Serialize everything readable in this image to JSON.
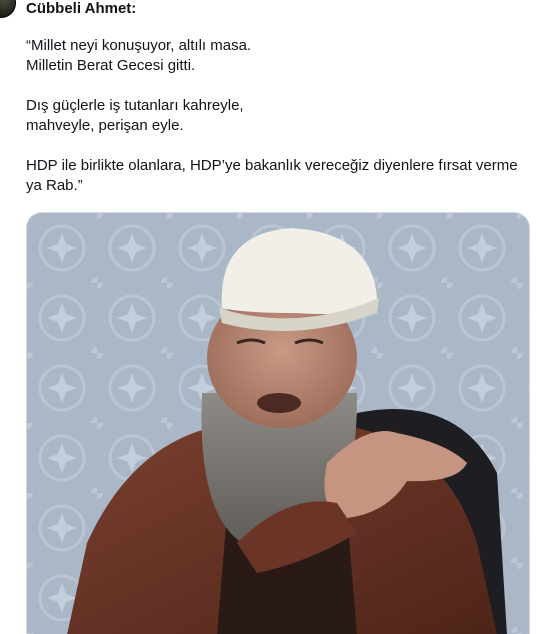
{
  "tweet": {
    "author_name": "Cübbeli Ahmet",
    "author_suffix": ":",
    "paragraphs": [
      [
        "“Millet neyi konuşuyor, altılı masa.",
        "Milletin Berat Gecesi gitti."
      ],
      [
        "Dış güçlerle iş tutanları kahreyle,",
        "mahveyle, perişan eyle."
      ],
      [
        "HDP ile birlikte olanlara, HDP’ye bakanlık vereceğiz diyenlere fırsat verme ya Rab.”"
      ]
    ]
  },
  "media": {
    "type": "video-frame",
    "subject": "bearded man in white turban gesturing"
  }
}
